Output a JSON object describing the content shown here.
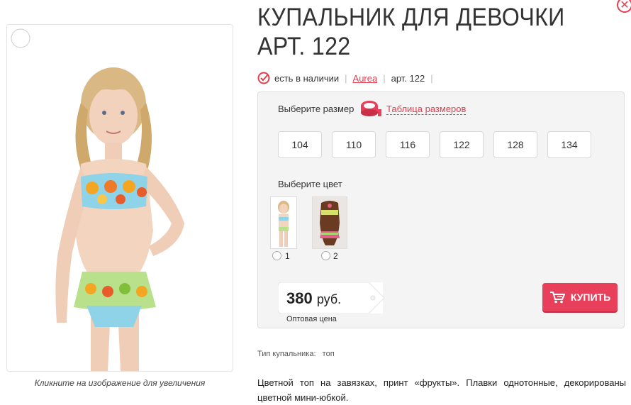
{
  "product": {
    "title": "КУПАЛЬНИК ДЛЯ ДЕВОЧКИ АРТ. 122",
    "availability": "есть в наличии",
    "brand": "Aurea",
    "article": "арт. 122",
    "image_caption": "Кликните на изображение для увеличения"
  },
  "sizes": {
    "label": "Выберите размер",
    "chart_link": "Таблица размеров",
    "options": [
      "104",
      "110",
      "116",
      "122",
      "128",
      "134"
    ]
  },
  "colors": {
    "label": "Выберите цвет",
    "options": [
      "1",
      "2"
    ]
  },
  "price": {
    "amount": "380",
    "currency": "руб.",
    "note": "Оптовая цена"
  },
  "buy_button": "КУПИТЬ",
  "attributes": {
    "type_label": "Тип купальника:",
    "type_value": "топ"
  },
  "description": "Цветной топ на завязках, принт «фрукты». Плавки однотонные, декорированы цветной мини-юбкой.",
  "colors_palette": {
    "accent": "#e0404f",
    "button": "#e8405a",
    "panel_bg": "#f4f4f4"
  },
  "icons": [
    "zoom-icon",
    "close-icon",
    "check-circle-icon",
    "measuring-tape-icon",
    "cart-icon"
  ]
}
